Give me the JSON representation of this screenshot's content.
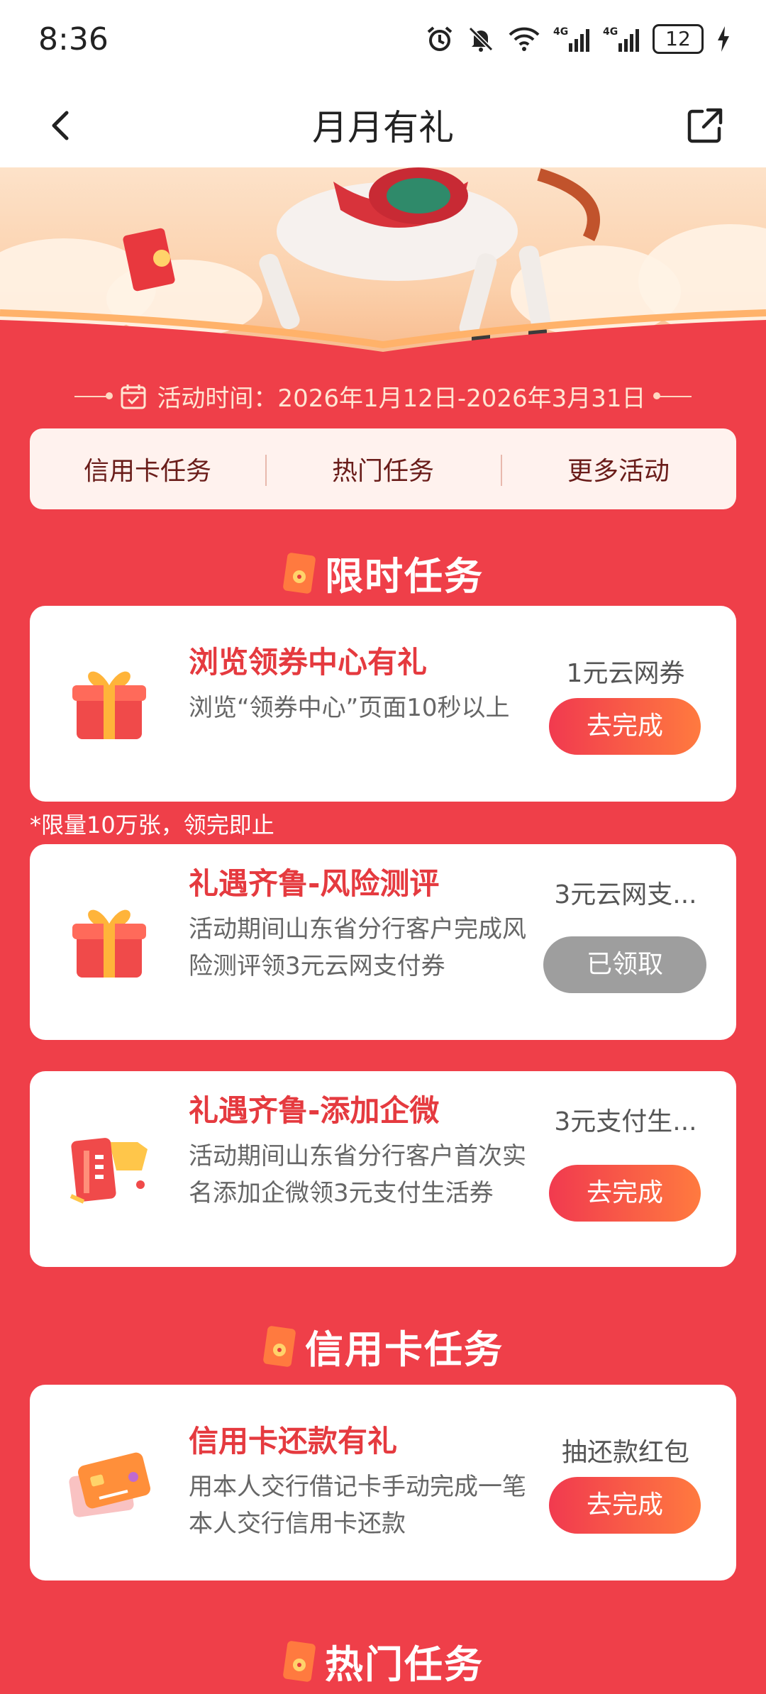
{
  "status_bar": {
    "time": "8:36",
    "battery": "12"
  },
  "header": {
    "title": "月月有礼"
  },
  "activity_period": "活动时间：2026年1月12日-2026年3月31日",
  "tabs": [
    {
      "label": "信用卡任务"
    },
    {
      "label": "热门任务"
    },
    {
      "label": "更多活动"
    }
  ],
  "sections": {
    "limited": {
      "title": "限时任务"
    },
    "credit": {
      "title": "信用卡任务"
    },
    "hot": {
      "title": "热门任务"
    }
  },
  "note": "*限量10万张，领完即止",
  "tasks": [
    {
      "title": "浏览领券中心有礼",
      "desc": "浏览“领券中心”页面10秒以上",
      "reward": "1元云网券",
      "button": "去完成",
      "icon": "gift-box-icon"
    },
    {
      "title": "礼遇齐鲁-风险测评",
      "desc": "活动期间山东省分行客户完成风险测评领3元云网支付券",
      "reward": "3元云网支...",
      "button": "已领取",
      "icon": "gift-box-icon"
    },
    {
      "title": "礼遇齐鲁-添加企微",
      "desc": "活动期间山东省分行客户首次实名添加企微领3元支付生活券",
      "reward": "3元支付生...",
      "button": "去完成",
      "icon": "coupon-ticket-icon"
    },
    {
      "title": "信用卡还款有礼",
      "desc": "用本人交行借记卡手动完成一笔本人交行信用卡还款",
      "reward": "抽还款红包",
      "button": "去完成",
      "icon": "credit-card-icon"
    }
  ],
  "colors": {
    "background": "#ef3f49",
    "accent": "#e53a3f",
    "button_start": "#f13a4f",
    "button_end": "#ff7a3f",
    "disabled": "#9e9e9e"
  }
}
